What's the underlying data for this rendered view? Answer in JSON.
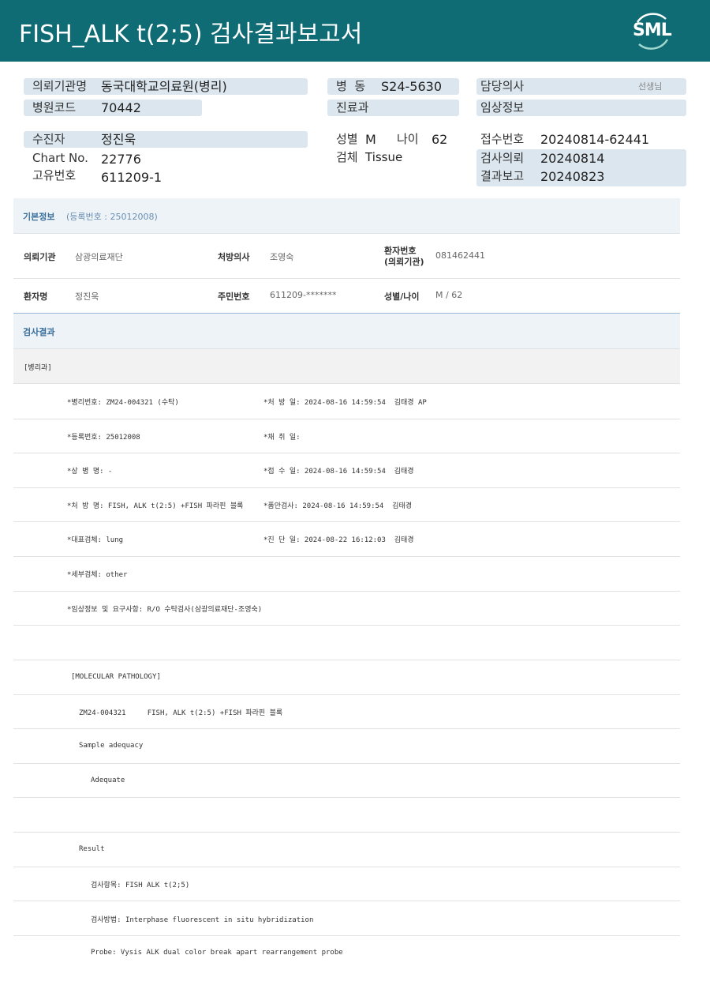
{
  "header": {
    "title": "FISH_ALK  t(2;5) 검사결과보고서",
    "logo_text": "SML",
    "bar_color": "#0f6b74"
  },
  "patient_header": {
    "req_inst_label": "의뢰기관명",
    "req_inst_value": "동국대학교의료원(병리)",
    "hosp_code_label": "병원코드",
    "hosp_code_value": "70442",
    "ward_label": "병  동",
    "ward_value": "S24-5630",
    "dept_label": "진료과",
    "doctor_label": "담당의사",
    "doctor_suffix": "선생님",
    "clinical_label": "임상정보",
    "patient_label": "수진자",
    "patient_value": "정진욱",
    "chart_label": "Chart No.",
    "chart_value": "22776",
    "uid_label": "고유번호",
    "uid_value": "611209-1",
    "sex_label": "성별",
    "sex_value": "M",
    "age_label": "나이",
    "age_value": "62",
    "specimen_label": "검체",
    "specimen_value": "Tissue",
    "receipt_label": "접수번호",
    "receipt_value": "20240814-62441",
    "request_label": "검사의뢰",
    "request_value": "20240814",
    "report_label": "결과보고",
    "report_value": "20240823"
  },
  "basic_info": {
    "heading": "기본정보",
    "reg_no": "(등록번호 : 25012008)",
    "inst_label": "의뢰기관",
    "inst_value": "삼광의료재단",
    "presc_label": "처방의사",
    "presc_value": "조영숙",
    "pt_no_label_1": "환자번호",
    "pt_no_label_2": "(의뢰기관)",
    "pt_no_value": "081462441",
    "name_label": "환자명",
    "name_value": "정진욱",
    "rrn_label": "주민번호",
    "rrn_value": "611209-*******",
    "sexage_label": "성별/나이",
    "sexage_value": "M / 62"
  },
  "results": {
    "heading": "검사결과",
    "pathology_tag": "[병리과]",
    "lines": [
      {
        "left": "*병리번호: ZM24-004321 (수탁)",
        "right": "*처 방 일: 2024-08-16 14:59:54  김태경 AP"
      },
      {
        "left": "*등록번호: 25012008",
        "right": "*채 취 일:"
      },
      {
        "left": "*상 병 명: -",
        "right": "*접 수 일: 2024-08-16 14:59:54  김태경"
      },
      {
        "left": "*처 방 명: FISH, ALK t(2:5) +FISH 파라핀 블록",
        "right": "*품안검사: 2024-08-16 14:59:54  김태경"
      },
      {
        "left": "*대표검체: lung",
        "right": "*진 단 일: 2024-08-22 16:12:03  김태경"
      },
      {
        "left": "*세부검체: other",
        "right": ""
      },
      {
        "left": "*임상정보 및 요구사항: R/O 수탁검사(삼광의료재단-조영숙)",
        "right": ""
      }
    ],
    "mol_path": "[MOLECULAR PATHOLOGY]",
    "case_line": "ZM24-004321     FISH, ALK t(2:5) +FISH 파라핀 블록",
    "sample_adequacy": "Sample adequacy",
    "adequate": "Adequate",
    "result": "Result",
    "test_item": "검사항목: FISH ALK t(2;5)",
    "test_method": "검사방법: Interphase fluorescent in situ hybridization",
    "probe": "Probe: Vysis ALK dual color break apart rearrangement probe"
  }
}
